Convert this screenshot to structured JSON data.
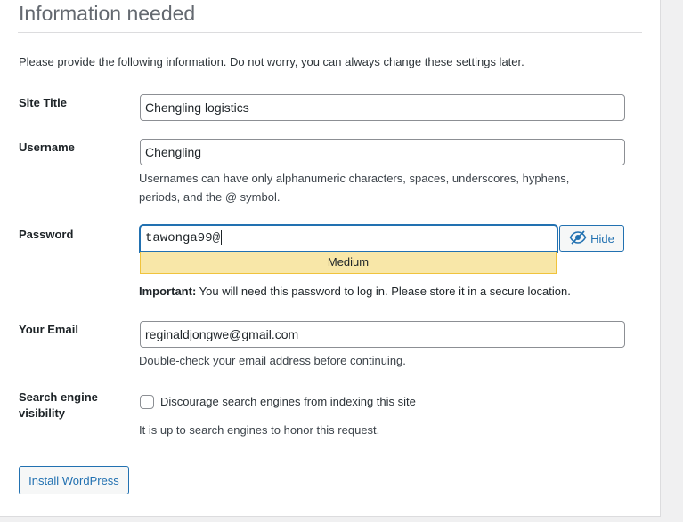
{
  "header": {
    "title": "Information needed",
    "intro": "Please provide the following information. Do not worry, you can always change these settings later."
  },
  "form": {
    "site_title": {
      "label": "Site Title",
      "value": "Chengling logistics"
    },
    "username": {
      "label": "Username",
      "value": "Chengling",
      "help_line1": "Usernames can have only alphanumeric characters, spaces, underscores, hyphens,",
      "help_line2": "periods, and the @ symbol."
    },
    "password": {
      "label": "Password",
      "value": "tawonga99@",
      "toggle_label": "Hide",
      "toggle_icon": "eye-slash-icon",
      "strength": "Medium",
      "important_label": "Important:",
      "important_text": " You will need this password to log in. Please store it in a secure location."
    },
    "email": {
      "label": "Your Email",
      "value": "reginaldjongwe@gmail.com",
      "help": "Double-check your email address before continuing."
    },
    "search_visibility": {
      "label_line1": "Search engine",
      "label_line2": "visibility",
      "checkbox_label": "Discourage search engines from indexing this site",
      "checked": false,
      "help": "It is up to search engines to honor this request."
    }
  },
  "actions": {
    "install_label": "Install WordPress"
  },
  "colors": {
    "accent": "#2271b1",
    "strength_medium_bg": "#f8e7a8",
    "strength_medium_border": "#f0c33c",
    "heading": "#646970"
  }
}
